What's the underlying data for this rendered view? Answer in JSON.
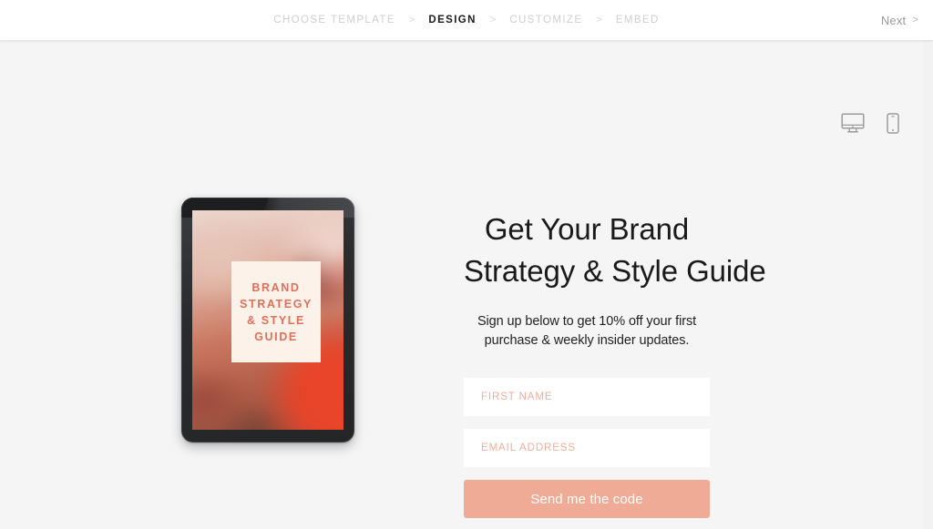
{
  "topbar": {
    "breadcrumb": [
      {
        "label": "CHOOSE TEMPLATE",
        "active": false
      },
      {
        "label": "DESIGN",
        "active": true
      },
      {
        "label": "CUSTOMIZE",
        "active": false
      },
      {
        "label": "EMBED",
        "active": false
      }
    ],
    "separator": ">",
    "next_label": "Next",
    "next_chevron": ">"
  },
  "device_toggles": [
    {
      "name": "desktop-view-toggle",
      "icon": "desktop-monitor-icon"
    },
    {
      "name": "mobile-view-toggle",
      "icon": "mobile-phone-icon"
    }
  ],
  "preview": {
    "tablet": {
      "cover_lines": [
        "BRAND",
        "STRATEGY",
        "& STYLE",
        "GUIDE"
      ],
      "cover_text_color": "#e0705a",
      "cover_card_color": "#fdf2ea"
    },
    "headline_line1": "Get Your Brand",
    "headline_line2": "Strategy & Style Guide",
    "subhead_line1": "Sign up below to get 10% off your first",
    "subhead_line2": "purchase & weekly insider updates.",
    "form": {
      "first_name_placeholder": "FIRST NAME",
      "email_placeholder": "EMAIL ADDRESS",
      "submit_label": "Send me the code",
      "accent_color": "#f0ab96",
      "placeholder_color": "#f3ae9c"
    }
  }
}
